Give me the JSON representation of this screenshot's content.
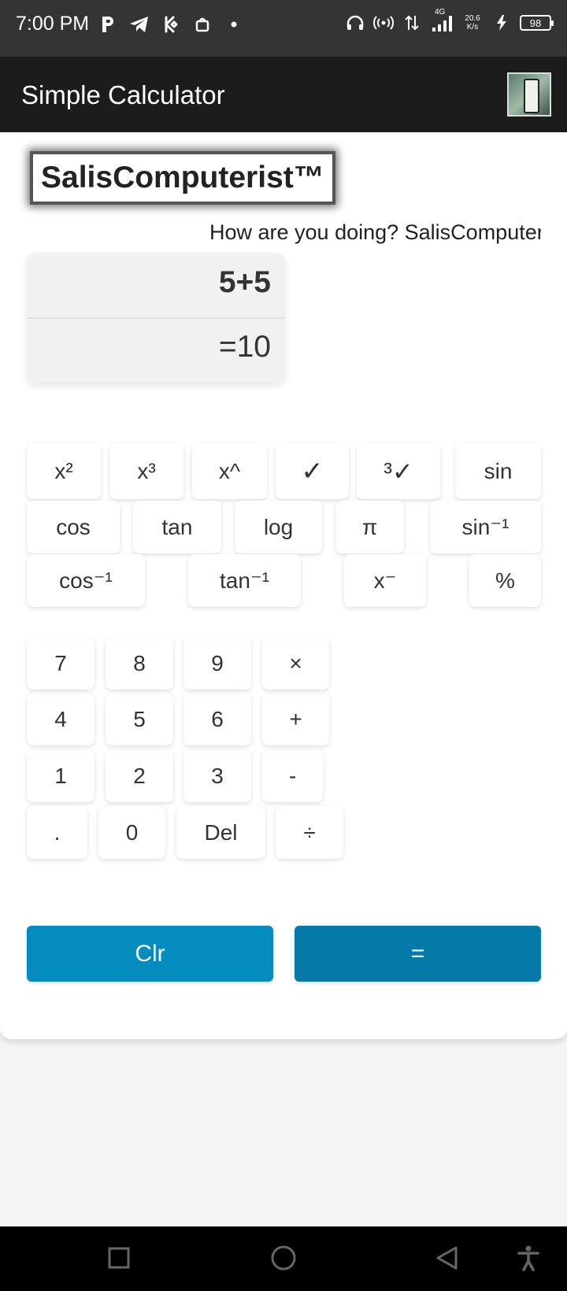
{
  "status_bar": {
    "time": "7:00 PM",
    "network_label": "4G",
    "net_speed_value": "20.6",
    "net_speed_unit": "K/s",
    "battery": "98"
  },
  "app_bar": {
    "title": "Simple Calculator"
  },
  "brand": {
    "name": "SalisComputerist™",
    "greeting": "How are you doing? SalisComputerist"
  },
  "display": {
    "expression": "5+5",
    "result": "=10"
  },
  "scientific_keys": {
    "row1": [
      "x²",
      "x³",
      "x^",
      "✓",
      "³✓",
      "sin"
    ],
    "row2": [
      "cos",
      "tan",
      "log",
      "π",
      "sin⁻¹"
    ],
    "row3": [
      "cos⁻¹",
      "tan⁻¹",
      "x⁻",
      "%"
    ]
  },
  "numpad": {
    "row1": [
      "7",
      "8",
      "9",
      "×"
    ],
    "row2": [
      "4",
      "5",
      "6",
      "+"
    ],
    "row3": [
      "1",
      "2",
      "3",
      "-"
    ],
    "row4": [
      ".",
      "0",
      "Del",
      "÷"
    ]
  },
  "actions": {
    "clear": "Clr",
    "equals": "="
  },
  "colors": {
    "clear_button": "#048cbf",
    "equals_button": "#0579a8",
    "status_bar": "#343434",
    "app_bar": "#1c1c1c"
  }
}
